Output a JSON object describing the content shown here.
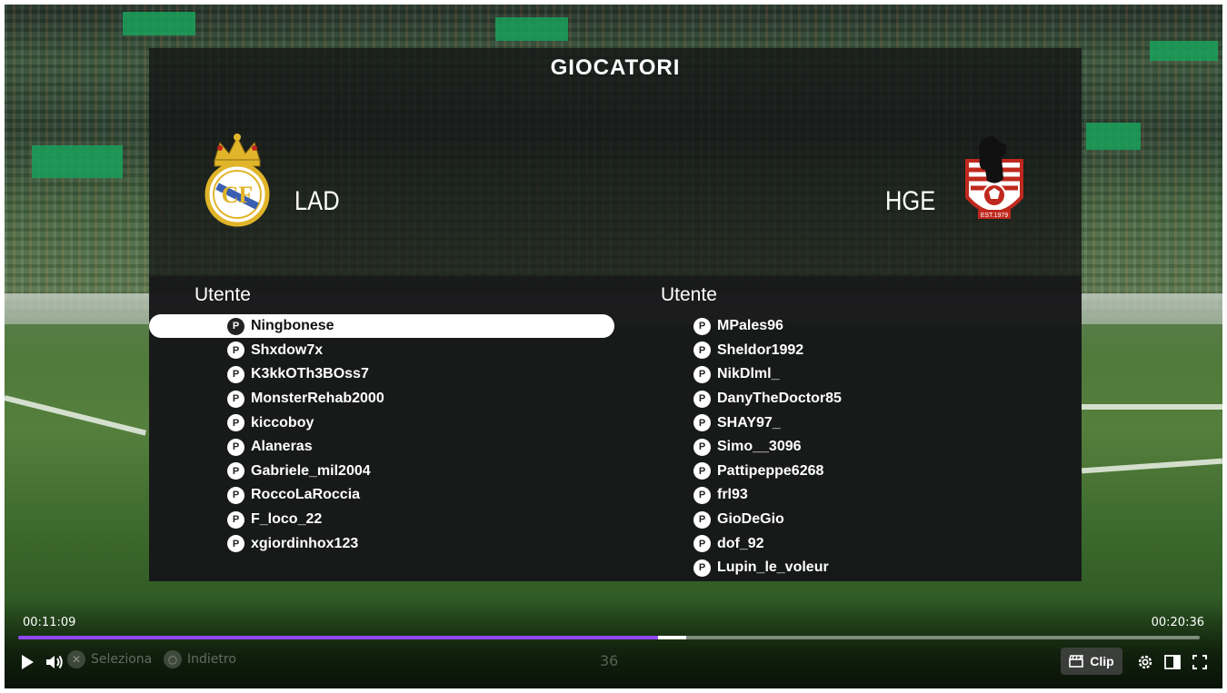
{
  "overlay": {
    "title": "GIOCATORI",
    "home_team": {
      "name": "LAD",
      "crest": "real-madrid-crest"
    },
    "away_team": {
      "name": "HGE",
      "crest": "bear-crest"
    },
    "home_column_header": "Utente",
    "away_column_header": "Utente",
    "home_players": [
      "Ningbonese",
      "Shxdow7x",
      "K3kkOTh3BOss7",
      "MonsterRehab2000",
      "kiccoboy",
      "Alaneras",
      "Gabriele_mil2004",
      "RoccoLaRoccia",
      "F_loco_22",
      "xgiordinhox123"
    ],
    "away_players": [
      "MPales96",
      "Sheldor1992",
      "NikDlml_",
      "DanyTheDoctor85",
      "SHAY97_",
      "Simo__3096",
      "Pattipeppe6268",
      "frl93",
      "GioDeGio",
      "dof_92",
      "Lupin_le_voleur"
    ],
    "selected_home_index": 0,
    "platform_icon": "playstation-icon"
  },
  "game_hud": {
    "select_hint": "Seleziona",
    "back_hint": "Indietro",
    "center_number": "36"
  },
  "player": {
    "current_time": "00:11:09",
    "total_time": "00:20:36",
    "progress_fraction": 0.5415,
    "buffer_fraction": 0.5655,
    "progress_color": "#9147ff",
    "clip_label": "Clip"
  }
}
